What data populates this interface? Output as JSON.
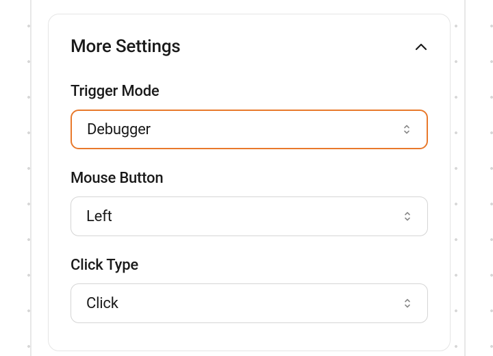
{
  "panel": {
    "title": "More Settings",
    "expanded": true
  },
  "fields": {
    "trigger_mode": {
      "label": "Trigger Mode",
      "value": "Debugger",
      "active": true
    },
    "mouse_button": {
      "label": "Mouse Button",
      "value": "Left",
      "active": false
    },
    "click_type": {
      "label": "Click Type",
      "value": "Click",
      "active": false
    }
  }
}
